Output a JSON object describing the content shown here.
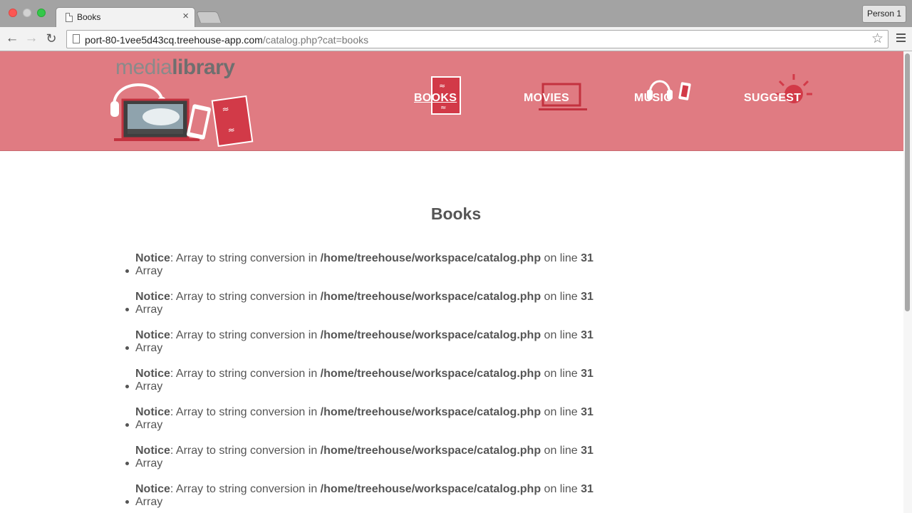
{
  "browser": {
    "tab_title": "Books",
    "tab_close": "×",
    "profile": "Person 1",
    "url_host": "port-80-1vee5d43cq.treehouse-app.com",
    "url_path": "/catalog.php?cat=books",
    "back_icon": "arrow-left",
    "forward_icon": "arrow-right",
    "reload_icon": "reload",
    "star_icon": "star",
    "menu_icon": "hamburger"
  },
  "site": {
    "logo_light": "media",
    "logo_bold": "library",
    "header_color": "#e07b82",
    "nav": [
      {
        "label": "BOOKS",
        "active": true
      },
      {
        "label": "MOVIES",
        "active": false
      },
      {
        "label": "MUSIC",
        "active": false
      },
      {
        "label": "SUGGEST",
        "active": false
      }
    ]
  },
  "page": {
    "title": "Books",
    "notice_label": "Notice",
    "notice_message": ": Array to string conversion in ",
    "notice_path": "/home/treehouse/workspace/catalog.php",
    "notice_line_text": " on line ",
    "notice_line": "31",
    "items": [
      "Array",
      "Array",
      "Array",
      "Array",
      "Array",
      "Array",
      "Array"
    ]
  }
}
